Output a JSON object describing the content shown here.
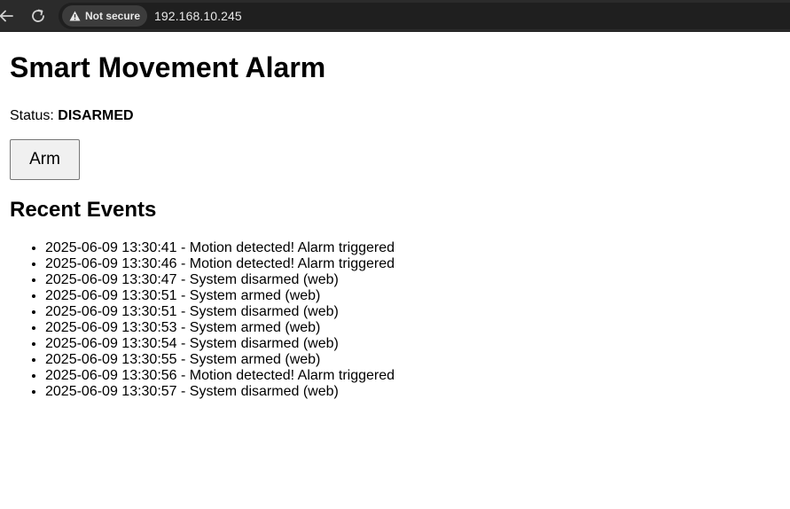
{
  "browser": {
    "security_label": "Not secure",
    "url": "192.168.10.245"
  },
  "page": {
    "title": "Smart Movement Alarm",
    "status_label": "Status:",
    "status_value": "DISARMED",
    "arm_button_label": "Arm",
    "events_heading": "Recent Events",
    "events": [
      "2025-06-09 13:30:41 - Motion detected! Alarm triggered",
      "2025-06-09 13:30:46 - Motion detected! Alarm triggered",
      "2025-06-09 13:30:47 - System disarmed (web)",
      "2025-06-09 13:30:51 - System armed (web)",
      "2025-06-09 13:30:51 - System disarmed (web)",
      "2025-06-09 13:30:53 - System armed (web)",
      "2025-06-09 13:30:54 - System disarmed (web)",
      "2025-06-09 13:30:55 - System armed (web)",
      "2025-06-09 13:30:56 - Motion detected! Alarm triggered",
      "2025-06-09 13:30:57 - System disarmed (web)"
    ]
  },
  "icons": {
    "back": "back-arrow-icon",
    "reload": "reload-icon",
    "warning": "warning-triangle-icon"
  }
}
